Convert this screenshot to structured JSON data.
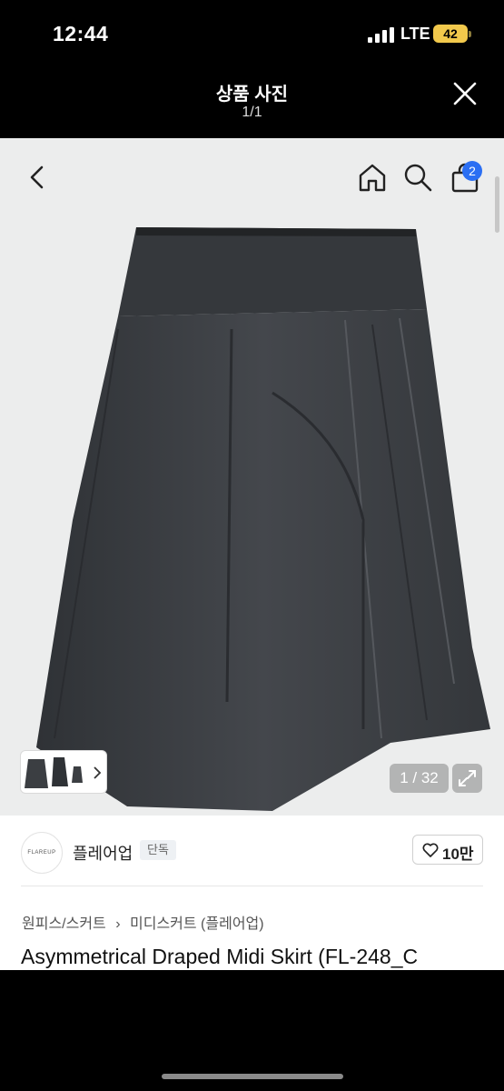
{
  "status_bar": {
    "time": "12:44",
    "network": "LTE",
    "battery": "42"
  },
  "modal": {
    "title": "상품 사진",
    "counter": "1/1",
    "close_icon": "close-icon"
  },
  "product_page": {
    "nav": {
      "back_icon": "chevron-left-icon",
      "home_icon": "home-icon",
      "search_icon": "search-icon",
      "bag_icon": "shopping-bag-icon",
      "bag_badge": "2"
    },
    "image_counter": "1 / 32",
    "seller": {
      "logo_text": "FLAREUP",
      "name": "플레어업",
      "badge": "단독",
      "likes": "10만"
    },
    "breadcrumb": [
      "원피스/스커트",
      "›",
      "미디스커트 (플레어업)"
    ],
    "title": "Asymmetrical Draped Midi Skirt (FL-248_C"
  },
  "colors": {
    "skirt": "#3b3e42",
    "badge_blue": "#2b6ff3",
    "battery": "#f2c94c"
  }
}
